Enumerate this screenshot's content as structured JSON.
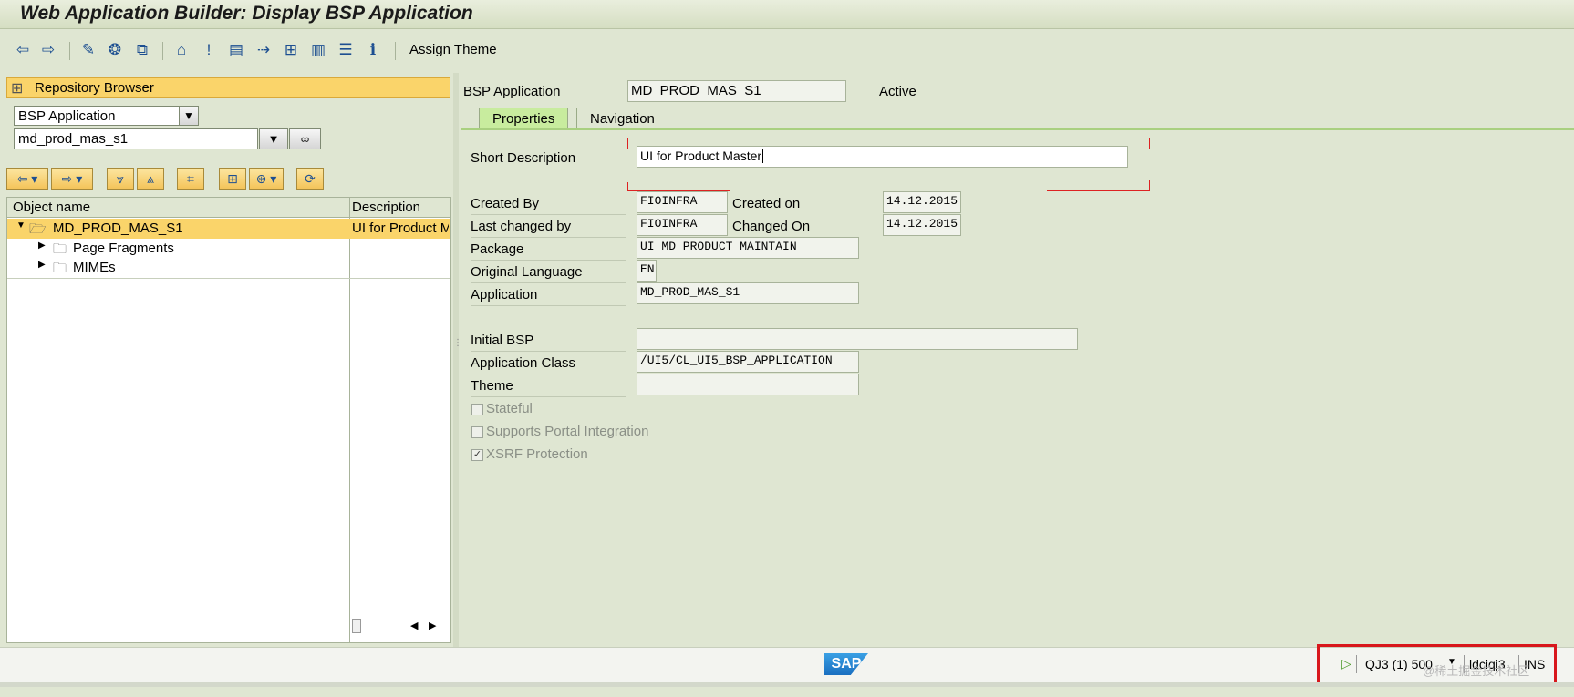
{
  "window": {
    "title": "Web Application Builder: Display BSP Application"
  },
  "toolbar": {
    "icons": [
      "back-arrow-icon",
      "forward-arrow-icon",
      "edit-toggle-icon",
      "activate-icon",
      "check-icon",
      "where-used-icon",
      "info-pin-icon",
      "display-object-icon",
      "navigation-icon",
      "object-list-icon",
      "hierarchy-icon",
      "printer-icon",
      "display-list-icon",
      "information-icon"
    ],
    "assign_theme": "Assign Theme"
  },
  "repository": {
    "header": "Repository Browser",
    "object_type": "BSP Application",
    "object_name": "md_prod_mas_s1",
    "columns": {
      "object_name": "Object name",
      "description": "Description"
    },
    "tree": [
      {
        "name": "MD_PROD_MAS_S1",
        "description": "UI for Product M"
      },
      {
        "name": "Page Fragments",
        "description": ""
      },
      {
        "name": "MIMEs",
        "description": ""
      }
    ]
  },
  "detail": {
    "bsp_application_label": "BSP Application",
    "bsp_application_value": "MD_PROD_MAS_S1",
    "status": "Active",
    "tabs": {
      "properties": "Properties",
      "navigation": "Navigation"
    },
    "short_description_label": "Short Description",
    "short_description_value": "UI for Product Master",
    "created_by_label": "Created By",
    "created_by_value": "FIOINFRA",
    "created_on_label": "Created on",
    "created_on_value": "14.12.2015",
    "last_changed_by_label": "Last changed by",
    "last_changed_by_value": "FIOINFRA",
    "changed_on_label": "Changed On",
    "changed_on_value": "14.12.2015",
    "package_label": "Package",
    "package_value": "UI_MD_PRODUCT_MAINTAIN",
    "original_language_label": "Original Language",
    "original_language_value": "EN",
    "application_label": "Application",
    "application_value": "MD_PROD_MAS_S1",
    "initial_bsp_label": "Initial BSP",
    "initial_bsp_value": "",
    "application_class_label": "Application Class",
    "application_class_value": "/UI5/CL_UI5_BSP_APPLICATION",
    "theme_label": "Theme",
    "theme_value": "",
    "stateful_label": "Stateful",
    "stateful_checked": false,
    "portal_label": "Supports Portal Integration",
    "portal_checked": false,
    "xsrf_label": "XSRF Protection",
    "xsrf_checked": true
  },
  "status_bar": {
    "logo": "SAP",
    "system": "QJ3 (1) 500",
    "host": "ldciqj3",
    "mode": "INS"
  },
  "watermark": "@稀土掘金技术社区",
  "colors": {
    "accent": "#fad46a",
    "highlight_box": "#d8171c",
    "tab_active": "#c8ec9e"
  }
}
